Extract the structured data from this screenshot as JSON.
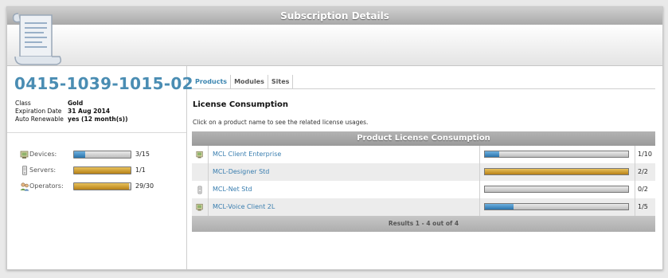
{
  "window": {
    "title": "Subscription Details"
  },
  "subscription": {
    "id": "0415-1039-1015-02",
    "info": [
      {
        "key": "Class",
        "value": "Gold"
      },
      {
        "key": "Expiration Date",
        "value": "31 Aug 2014"
      },
      {
        "key": "Auto Renewable",
        "value": "yes (12 month(s))"
      }
    ],
    "stats": [
      {
        "label": "Devices:",
        "count": "3/15",
        "fraction": 0.2,
        "color": "blue",
        "icon": "devices-icon"
      },
      {
        "label": "Servers:",
        "count": "1/1",
        "fraction": 1.0,
        "color": "gold",
        "icon": "server-icon"
      },
      {
        "label": "Operators:",
        "count": "29/30",
        "fraction": 0.967,
        "color": "gold",
        "icon": "operators-icon"
      }
    ]
  },
  "tabs": [
    {
      "label": "Products",
      "active": true
    },
    {
      "label": "Modules",
      "active": false
    },
    {
      "label": "Sites",
      "active": false
    }
  ],
  "section": {
    "title": "License Consumption",
    "hint": "Click on a product name to see the related license usages."
  },
  "table": {
    "header": "Product License Consumption",
    "rows": [
      {
        "name": "MCL Client Enterprise",
        "count": "1/10",
        "fraction": 0.1,
        "color": "blue",
        "icon": "device-icon"
      },
      {
        "name": "MCL-Designer Std",
        "count": "2/2",
        "fraction": 1.0,
        "color": "gold",
        "icon": ""
      },
      {
        "name": "MCL-Net Std",
        "count": "0/2",
        "fraction": 0.0,
        "color": "blue",
        "icon": "server-icon"
      },
      {
        "name": "MCL-Voice Client 2L",
        "count": "1/5",
        "fraction": 0.2,
        "color": "blue",
        "icon": "device-icon"
      }
    ],
    "footer": "Results 1 - 4 out of 4"
  },
  "colors": {
    "accent": "#4a8db3",
    "link": "#3a7eaf",
    "gold": "#c8921f",
    "blue": "#2f7cb5"
  }
}
